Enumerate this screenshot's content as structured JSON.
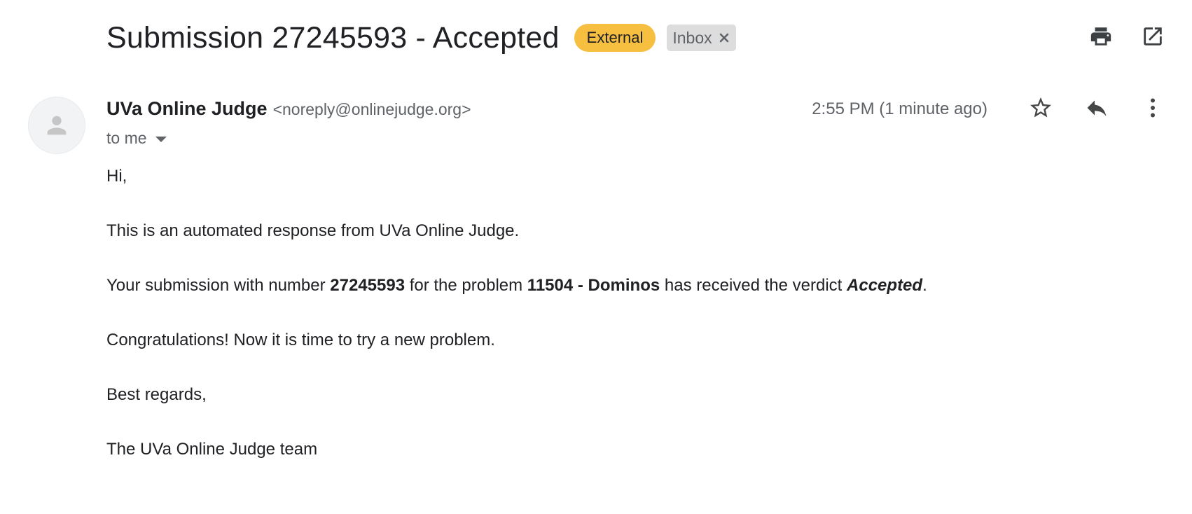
{
  "email": {
    "subject": "Submission 27245593 - Accepted",
    "labels": {
      "external": "External",
      "inbox": "Inbox",
      "remove": "×"
    },
    "sender": {
      "name": "UVa Online Judge",
      "email": "<noreply@onlinejudge.org>"
    },
    "recipient": "to me",
    "timestamp": "2:55 PM (1 minute ago)",
    "body": {
      "greeting": "Hi,",
      "intro": "This is an automated response from UVa Online Judge.",
      "verdict_prefix": "Your submission with number ",
      "submission_number": "27245593",
      "verdict_middle": " for the problem ",
      "problem": "11504 - Dominos",
      "verdict_suffix": " has received the verdict ",
      "verdict": "Accepted",
      "verdict_end": ".",
      "congrats": "Congratulations! Now it is time to try a new problem.",
      "closing": "Best regards,",
      "signature": "The UVa Online Judge team"
    }
  },
  "icons": {
    "print": "print-icon",
    "open_new_window": "open-in-new-icon",
    "star": "star-icon",
    "reply": "reply-icon",
    "more": "more-vert-icon",
    "avatar": "person-icon"
  },
  "colors": {
    "external_chip": "#f6bf40",
    "inbox_chip": "#dddddd",
    "text": "#202124",
    "secondary_text": "#5f6368"
  }
}
